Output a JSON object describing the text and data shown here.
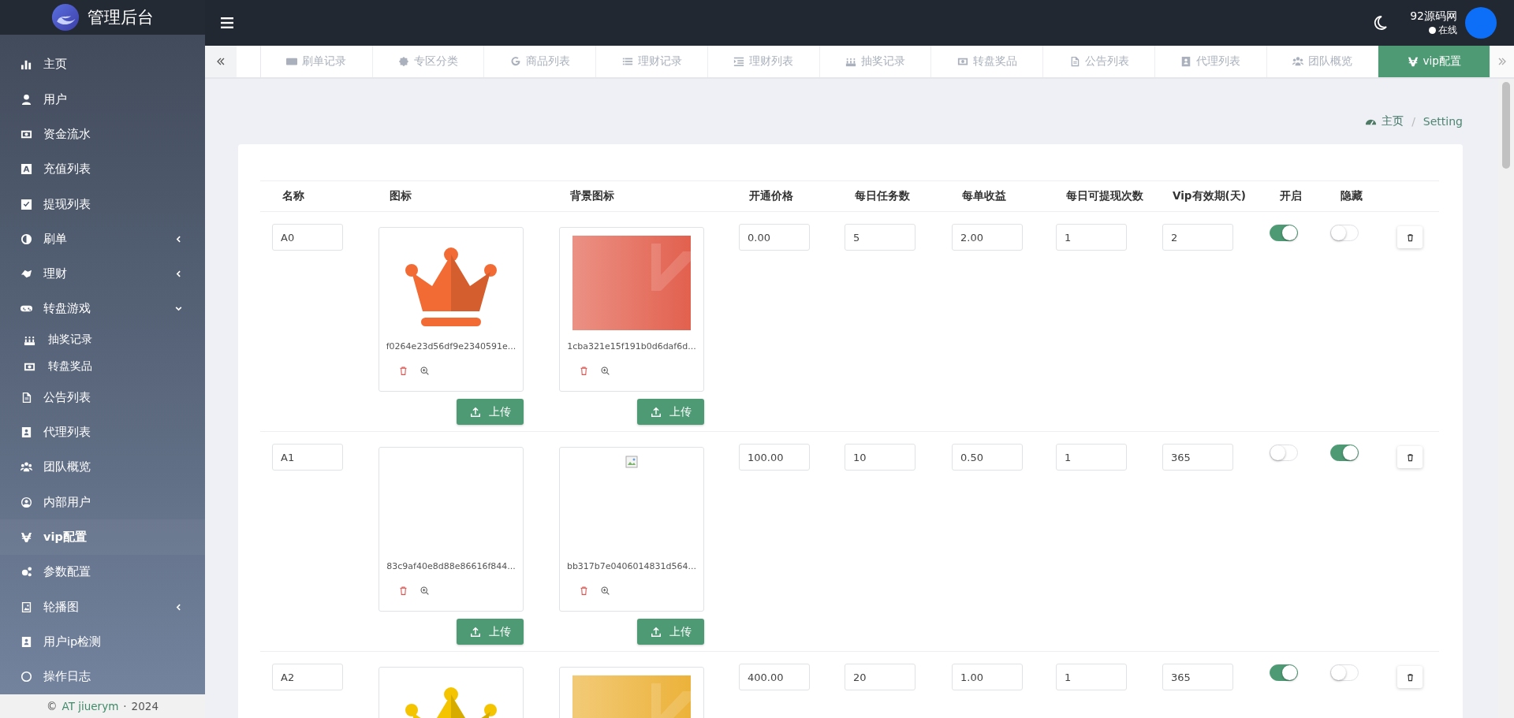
{
  "brand": {
    "title": "管理后台"
  },
  "sidebar": {
    "items": [
      {
        "label": "主页",
        "selected": false
      },
      {
        "label": "用户",
        "selected": false
      },
      {
        "label": "资金流水",
        "selected": false
      },
      {
        "label": "充值列表",
        "selected": false
      },
      {
        "label": "提现列表",
        "selected": false
      },
      {
        "label": "刷单",
        "selected": false,
        "expanded": false
      },
      {
        "label": "理财",
        "selected": false,
        "expanded": false
      },
      {
        "label": "转盘游戏",
        "selected": false,
        "expanded": true,
        "children": [
          {
            "label": "抽奖记录",
            "selected": false
          },
          {
            "label": "转盘奖品",
            "selected": false
          }
        ]
      },
      {
        "label": "公告列表",
        "selected": false
      },
      {
        "label": "代理列表",
        "selected": false
      },
      {
        "label": "团队概览",
        "selected": false
      },
      {
        "label": "内部用户",
        "selected": false
      },
      {
        "label": "vip配置",
        "selected": true
      },
      {
        "label": "参数配置",
        "selected": false
      },
      {
        "label": "轮播图",
        "selected": false,
        "expanded": false
      },
      {
        "label": "用户ip检测",
        "selected": false
      },
      {
        "label": "操作日志",
        "selected": false
      }
    ],
    "footer": {
      "copyright": "©",
      "link": "AT jiuerym",
      "separator": "·",
      "year": "2024"
    }
  },
  "header": {
    "user_name": "92源码网",
    "status": "在线"
  },
  "tabs": [
    {
      "label": "刷单记录",
      "selected": false
    },
    {
      "label": "专区分类",
      "selected": false
    },
    {
      "label": "商品列表",
      "selected": false
    },
    {
      "label": "理财记录",
      "selected": false
    },
    {
      "label": "理财列表",
      "selected": false
    },
    {
      "label": "抽奖记录",
      "selected": false
    },
    {
      "label": "转盘奖品",
      "selected": false
    },
    {
      "label": "公告列表",
      "selected": false
    },
    {
      "label": "代理列表",
      "selected": false
    },
    {
      "label": "团队概览",
      "selected": false
    },
    {
      "label": "vip配置",
      "selected": true
    }
  ],
  "breadcrumb": {
    "items": [
      "主页",
      "Setting"
    ],
    "separator": "/"
  },
  "table": {
    "columns": [
      "名称",
      "图标",
      "背景图标",
      "开通价格",
      "每日任务数",
      "每单收益",
      "每日可提现次数",
      "Vip有效期(天)",
      "开启",
      "隐藏"
    ],
    "rows": [
      {
        "name": "A0",
        "icon": {
          "kind": "crown",
          "color": "#f26b35",
          "filename": "f0264e23d56df9e2340591e...",
          "upload": "上传"
        },
        "background": {
          "kind": "gradient",
          "color": "#e2604e",
          "filename": "1cba321e15f191b0d6daf6d...",
          "upload": "上传"
        },
        "price": "0.00",
        "daily_tasks": "5",
        "order_income": "2.00",
        "daily_withdrawals": "1",
        "validity_days": "2",
        "enabled": true,
        "hidden": false
      },
      {
        "name": "A1",
        "icon": {
          "kind": "none",
          "filename": "83c9af40e8d88e86616f844...",
          "upload": "上传"
        },
        "background": {
          "kind": "broken",
          "filename": "bb317b7e0406014831d564...",
          "upload": "上传"
        },
        "price": "100.00",
        "daily_tasks": "10",
        "order_income": "0.50",
        "daily_withdrawals": "1",
        "validity_days": "365",
        "enabled": false,
        "hidden": true
      },
      {
        "name": "A2",
        "icon": {
          "kind": "crown",
          "color": "#f5c400"
        },
        "background": {
          "kind": "gradient",
          "color": "#ecb23a"
        },
        "price": "400.00",
        "daily_tasks": "20",
        "order_income": "1.00",
        "daily_withdrawals": "1",
        "validity_days": "365",
        "enabled": true,
        "hidden": false
      }
    ]
  }
}
